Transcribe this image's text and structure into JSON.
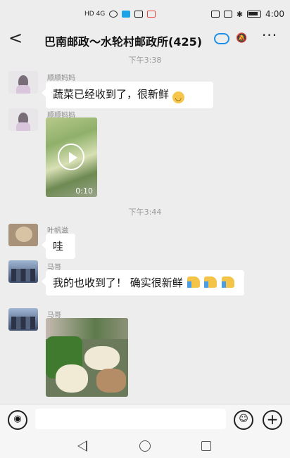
{
  "status_bar": {
    "left_text": "HD 4G",
    "time": "4:00"
  },
  "header": {
    "back_label": "<",
    "title": "巴南邮政～水轮村邮政所(425)",
    "more_label": "···"
  },
  "messages": [
    {
      "time": "下午3:38"
    },
    {
      "sender": "顺顺妈妈",
      "text": "蔬菜已经收到了，很新鲜",
      "emoji": "smile"
    },
    {
      "sender": "顺顺妈妈",
      "type": "video",
      "duration": "0:10"
    },
    {
      "time": "下午3:44"
    },
    {
      "sender": "叶帆滋",
      "text": "哇"
    },
    {
      "sender": "马哥",
      "text": "我的也收到了！ 确实很新鲜"
    },
    {
      "sender": "马哥",
      "type": "image"
    }
  ],
  "input_bar": {
    "placeholder": ""
  },
  "colors": {
    "background": "#ededed",
    "bubble": "#ffffff",
    "accent_blue": "#1e8fe6"
  }
}
